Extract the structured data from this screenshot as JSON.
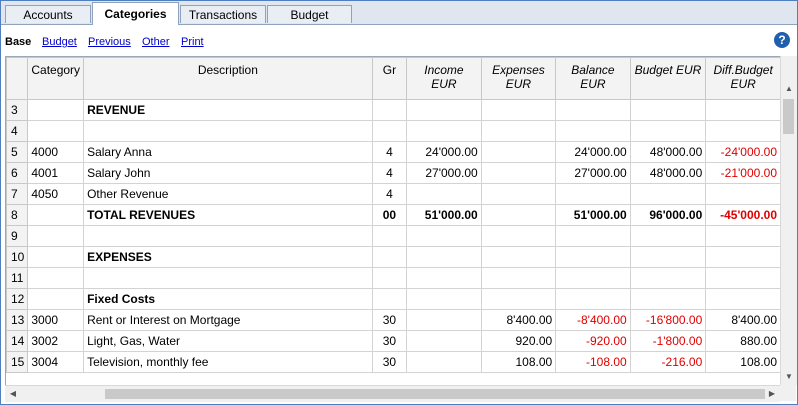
{
  "tabs": [
    {
      "label": "Accounts"
    },
    {
      "label": "Categories"
    },
    {
      "label": "Transactions"
    },
    {
      "label": "Budget"
    }
  ],
  "views": {
    "base": "Base",
    "links": [
      "Budget",
      "Previous",
      "Other",
      "Print"
    ]
  },
  "help_icon": "?",
  "columns": {
    "rownum": "",
    "category": "Category",
    "description": "Description",
    "gr": "Gr",
    "income": "Income EUR",
    "expenses": "Expenses EUR",
    "balance": "Balance EUR",
    "budget": "Budget EUR",
    "diff": "Diff.Budget EUR"
  },
  "rows": [
    {
      "n": "3",
      "category": "",
      "description": "REVENUE",
      "gr": "",
      "income": "",
      "expenses": "",
      "balance": "",
      "budget": "",
      "diff": "",
      "bold": true
    },
    {
      "n": "4",
      "category": "",
      "description": "",
      "gr": "",
      "income": "",
      "expenses": "",
      "balance": "",
      "budget": "",
      "diff": ""
    },
    {
      "n": "5",
      "category": "4000",
      "description": "Salary Anna",
      "gr": "4",
      "income": "24'000.00",
      "expenses": "",
      "balance": "24'000.00",
      "budget": "48'000.00",
      "diff": "-24'000.00"
    },
    {
      "n": "6",
      "category": "4001",
      "description": "Salary John",
      "gr": "4",
      "income": "27'000.00",
      "expenses": "",
      "balance": "27'000.00",
      "budget": "48'000.00",
      "diff": "-21'000.00"
    },
    {
      "n": "7",
      "category": "4050",
      "description": "Other Revenue",
      "gr": "4",
      "income": "",
      "expenses": "",
      "balance": "",
      "budget": "",
      "diff": ""
    },
    {
      "n": "8",
      "category": "",
      "description": "TOTAL REVENUES",
      "gr": "00",
      "income": "51'000.00",
      "expenses": "",
      "balance": "51'000.00",
      "budget": "96'000.00",
      "diff": "-45'000.00",
      "bold": true
    },
    {
      "n": "9",
      "category": "",
      "description": "",
      "gr": "",
      "income": "",
      "expenses": "",
      "balance": "",
      "budget": "",
      "diff": ""
    },
    {
      "n": "10",
      "category": "",
      "description": "EXPENSES",
      "gr": "",
      "income": "",
      "expenses": "",
      "balance": "",
      "budget": "",
      "diff": "",
      "bold": true
    },
    {
      "n": "11",
      "category": "",
      "description": "",
      "gr": "",
      "income": "",
      "expenses": "",
      "balance": "",
      "budget": "",
      "diff": ""
    },
    {
      "n": "12",
      "category": "",
      "description": "Fixed Costs",
      "gr": "",
      "income": "",
      "expenses": "",
      "balance": "",
      "budget": "",
      "diff": "",
      "bold": true
    },
    {
      "n": "13",
      "category": "3000",
      "description": "Rent or Interest on Mortgage",
      "gr": "30",
      "income": "",
      "expenses": "8'400.00",
      "balance": "-8'400.00",
      "budget": "-16'800.00",
      "diff": "8'400.00"
    },
    {
      "n": "14",
      "category": "3002",
      "description": "Light, Gas, Water",
      "gr": "30",
      "income": "",
      "expenses": "920.00",
      "balance": "-920.00",
      "budget": "-1'800.00",
      "diff": "880.00"
    },
    {
      "n": "15",
      "category": "3004",
      "description": "Television, monthly fee",
      "gr": "30",
      "income": "",
      "expenses": "108.00",
      "balance": "-108.00",
      "budget": "-216.00",
      "diff": "108.00"
    }
  ],
  "colors": {
    "negative": "#e00000",
    "link": "#0000cc",
    "help": "#1f5fae"
  }
}
